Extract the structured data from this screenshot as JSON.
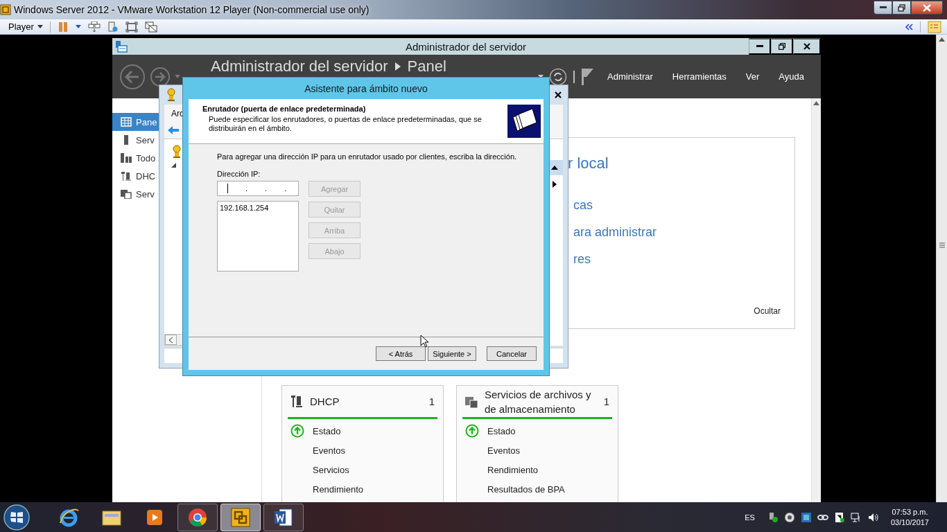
{
  "host_window": {
    "title": "Windows Server 2012 - VMware Workstation 12 Player (Non-commercial use only)"
  },
  "player_toolbar": {
    "menu_label": "Player"
  },
  "server_manager": {
    "title": "Administrador del servidor",
    "breadcrumb": [
      "Administrador del servidor",
      "Panel"
    ],
    "menu": [
      "Administrar",
      "Herramientas",
      "Ver",
      "Ayuda"
    ],
    "nav": [
      {
        "label": "Pane",
        "kind": "dashboard",
        "selected": true
      },
      {
        "label": "Serv",
        "kind": "server",
        "selected": false
      },
      {
        "label": "Todo",
        "kind": "servers",
        "selected": false
      },
      {
        "label": "DHC",
        "kind": "dhcp",
        "selected": false
      },
      {
        "label": "Serv",
        "kind": "files",
        "selected": false
      }
    ],
    "welcome": {
      "heading": "r local",
      "links": [
        "cas",
        "ara administrar",
        "res"
      ],
      "hide": "Ocultar"
    },
    "tiles": [
      {
        "kind": "dhcp",
        "title": "DHCP",
        "count": "1",
        "items": [
          {
            "label": "Estado",
            "healthy": true
          },
          {
            "label": "Eventos",
            "healthy": false
          },
          {
            "label": "Servicios",
            "healthy": false
          },
          {
            "label": "Rendimiento",
            "healthy": false
          }
        ]
      },
      {
        "kind": "files",
        "title": "Servicios de archivos y de almacenamiento",
        "count": "1",
        "items": [
          {
            "label": "Estado",
            "healthy": true
          },
          {
            "label": "Eventos",
            "healthy": false
          },
          {
            "label": "Rendimiento",
            "healthy": false
          },
          {
            "label": "Resultados de BPA",
            "healthy": false
          }
        ]
      }
    ]
  },
  "mmc_window": {
    "menu": "Arc"
  },
  "wizard": {
    "title": "Asistente para ámbito nuevo",
    "heading": "Enrutador (puerta de enlace predeterminada)",
    "subheading": "Puede especificar los enrutadores, o puertas de enlace predeterminadas, que se distribuirán en el ámbito.",
    "instruction": "Para agregar una dirección IP para un enrutador usado por clientes, escriba la dirección.",
    "ip_label": "Dirección IP:",
    "ip_separators": [
      ".",
      ".",
      "."
    ],
    "routers": [
      "192.168.1.254"
    ],
    "side_buttons": [
      {
        "label": "Agregar",
        "disabled": true
      },
      {
        "label": "Quitar",
        "disabled": true
      },
      {
        "label": "Arriba",
        "disabled": true
      },
      {
        "label": "Abajo",
        "disabled": true
      }
    ],
    "footer_buttons": [
      {
        "label": "< Atrás",
        "disabled": false
      },
      {
        "label": "Siguiente >",
        "disabled": false
      },
      {
        "label": "Cancelar",
        "disabled": false
      }
    ]
  },
  "taskbar": {
    "apps": [
      {
        "kind": "ie",
        "running": false,
        "active": false
      },
      {
        "kind": "explorer",
        "running": false,
        "active": false
      },
      {
        "kind": "media",
        "running": false,
        "active": false
      },
      {
        "kind": "chrome",
        "running": true,
        "active": false
      },
      {
        "kind": "vmware",
        "running": true,
        "active": true
      },
      {
        "kind": "word",
        "running": true,
        "active": false
      }
    ],
    "language": "ES",
    "time": "07:53 p.m.",
    "date": "03/10/2017"
  }
}
